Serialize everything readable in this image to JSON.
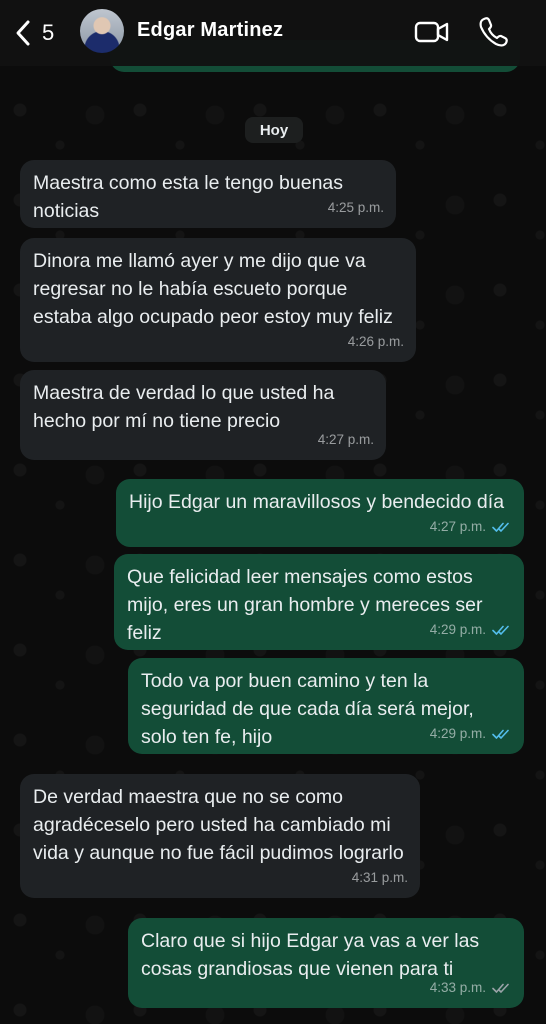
{
  "header": {
    "back_count": "5",
    "contact_name": "Edgar Martinez",
    "icons": {
      "back": "chevron-left-icon",
      "video": "video-camera-icon",
      "call": "phone-icon"
    }
  },
  "date_chip": "Hoy",
  "messages": [
    {
      "direction": "incoming",
      "text": "Maestra como esta le tengo buenas noticias",
      "time": "4:25 p.m."
    },
    {
      "direction": "incoming",
      "text": "Dinora me llamó ayer y me dijo que va regresar no le había escueto porque estaba algo ocupado peor estoy muy feliz",
      "time": "4:26 p.m."
    },
    {
      "direction": "incoming",
      "text": "Maestra de verdad lo que usted ha hecho por mí no tiene precio",
      "time": "4:27 p.m."
    },
    {
      "direction": "outgoing",
      "text": "Hijo Edgar un maravillosos y bendecido día",
      "time": "4:27 p.m.",
      "status": "read"
    },
    {
      "direction": "outgoing",
      "text": "Que felicidad leer mensajes como estos mijo, eres un gran hombre y mereces ser feliz",
      "time": "4:29 p.m.",
      "status": "read"
    },
    {
      "direction": "outgoing",
      "text": "Todo va por buen camino y ten la seguridad de que cada día será mejor, solo ten fe, hijo",
      "time": "4:29 p.m.",
      "status": "read"
    },
    {
      "direction": "incoming",
      "text": "De verdad maestra que no se como agradéceselo pero usted ha cambiado mi vida y aunque no fue fácil pudimos lograrlo",
      "time": "4:31 p.m."
    },
    {
      "direction": "outgoing",
      "text": "Claro que si hijo Edgar ya vas a ver las cosas grandiosas que vienen para ti",
      "time": "4:33 p.m.",
      "status": "delivered"
    }
  ],
  "colors": {
    "incoming_bubble": "#1f2225",
    "outgoing_bubble": "#134d37",
    "read_ticks": "#53bdeb",
    "delivered_ticks": "#9aa3a8"
  }
}
